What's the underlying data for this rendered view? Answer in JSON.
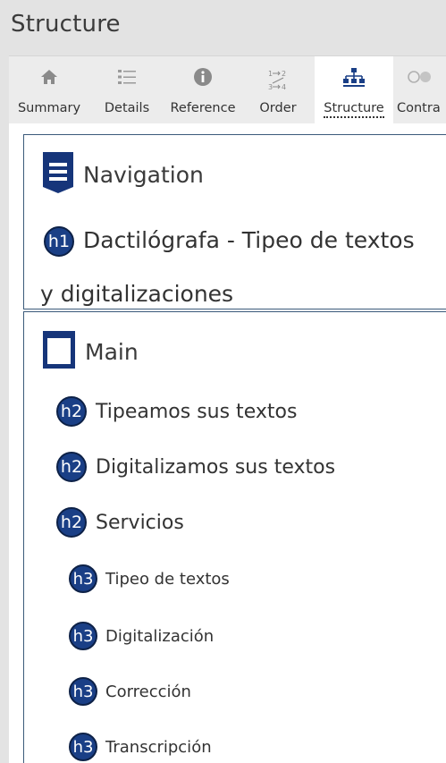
{
  "panel": {
    "title": "Structure"
  },
  "tabs": [
    {
      "label": "Summary",
      "icon": "home-icon",
      "active": false
    },
    {
      "label": "Details",
      "icon": "list-icon",
      "active": false
    },
    {
      "label": "Reference",
      "icon": "info-icon",
      "active": false
    },
    {
      "label": "Order",
      "icon": "order-icon",
      "active": false
    },
    {
      "label": "Structure",
      "icon": "structure-icon",
      "active": true
    },
    {
      "label": "Contra",
      "icon": "contrast-icon",
      "active": false
    }
  ],
  "navigation": {
    "label": "Navigation",
    "icon": "navigation-landmark-icon",
    "heading": {
      "level": "h1",
      "text": "Dactilógrafa - Tipeo de textos y digitalizaciones"
    }
  },
  "main": {
    "label": "Main",
    "icon": "main-landmark-icon",
    "headings": [
      {
        "level": "h2",
        "text": "Tipeamos sus textos"
      },
      {
        "level": "h2",
        "text": "Digitalizamos sus textos"
      },
      {
        "level": "h2",
        "text": "Servicios"
      },
      {
        "level": "h3",
        "text": "Tipeo de textos"
      },
      {
        "level": "h3",
        "text": "Digitalización"
      },
      {
        "level": "h3",
        "text": "Corrección"
      },
      {
        "level": "h3",
        "text": "Transcripción"
      }
    ]
  },
  "colors": {
    "badge": "#1a3f86",
    "border": "#3b5a7a",
    "background": "#e3e3e3"
  }
}
